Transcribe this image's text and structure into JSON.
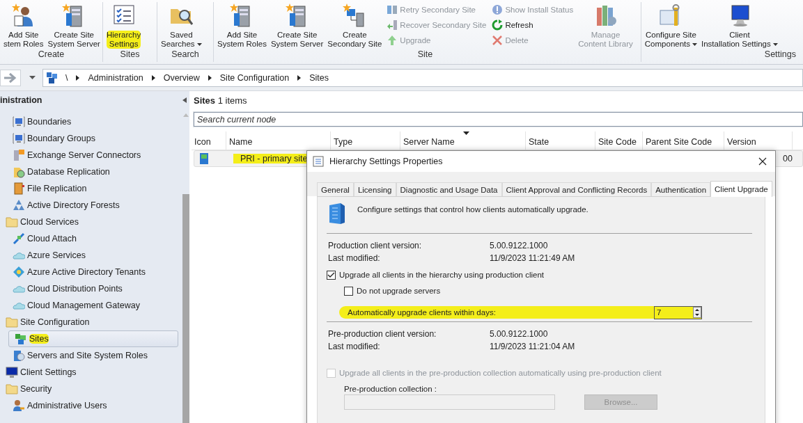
{
  "ribbon": {
    "groups": [
      {
        "label": "Create",
        "items": [
          {
            "kind": "large",
            "lines": [
              "Add Site",
              "stem Roles"
            ],
            "dropdown": false,
            "disabled": false,
            "highlighted": false
          },
          {
            "kind": "large",
            "lines": [
              "Create Site",
              "System Server"
            ],
            "dropdown": false,
            "disabled": false,
            "highlighted": false
          }
        ]
      },
      {
        "label": "Sites",
        "items": [
          {
            "kind": "large",
            "lines": [
              "Hierarchy",
              "Settings"
            ],
            "dropdown": false,
            "disabled": false,
            "highlighted": true
          }
        ]
      },
      {
        "label": "Search",
        "items": [
          {
            "kind": "large",
            "lines": [
              "Saved",
              "Searches"
            ],
            "dropdown": true,
            "disabled": false,
            "highlighted": false
          }
        ]
      },
      {
        "label": "Site",
        "items": [
          {
            "kind": "large",
            "lines": [
              "Add Site",
              "System Roles"
            ],
            "dropdown": false,
            "disabled": false,
            "highlighted": false
          },
          {
            "kind": "large",
            "lines": [
              "Create Site",
              "System Server"
            ],
            "dropdown": false,
            "disabled": false,
            "highlighted": false
          },
          {
            "kind": "large",
            "lines": [
              "Create",
              "Secondary Site"
            ],
            "dropdown": false,
            "disabled": false,
            "highlighted": false
          },
          {
            "kind": "stack",
            "items": [
              {
                "label": "Retry Secondary Site",
                "disabled": true
              },
              {
                "label": "Recover Secondary Site",
                "disabled": true
              },
              {
                "label": "Upgrade",
                "disabled": true
              }
            ]
          },
          {
            "kind": "stack",
            "items": [
              {
                "label": "Show Install Status",
                "disabled": true
              },
              {
                "label": "Refresh",
                "disabled": false
              },
              {
                "label": "Delete",
                "disabled": true
              }
            ]
          },
          {
            "kind": "large",
            "lines": [
              "Manage",
              "Content Library"
            ],
            "dropdown": false,
            "disabled": true,
            "highlighted": false
          }
        ]
      },
      {
        "label": "Settings",
        "items": [
          {
            "kind": "large",
            "lines": [
              "Configure Site",
              "Components"
            ],
            "dropdown": true,
            "disabled": false,
            "highlighted": false
          },
          {
            "kind": "large",
            "lines": [
              "Client",
              "Installation Settings"
            ],
            "dropdown": true,
            "disabled": false,
            "highlighted": false
          }
        ]
      }
    ]
  },
  "breadcrumb": [
    "\\",
    "Administration",
    "Overview",
    "Site Configuration",
    "Sites"
  ],
  "tree": {
    "title": "inistration",
    "items": [
      {
        "children": [
          {
            "label": "Boundaries",
            "selected": false
          },
          {
            "label": "Boundary Groups",
            "selected": false
          },
          {
            "label": "Exchange Server Connectors",
            "selected": false
          },
          {
            "label": "Database Replication",
            "selected": false
          },
          {
            "label": "File Replication",
            "selected": false
          },
          {
            "label": "Active Directory Forests",
            "selected": false
          }
        ]
      },
      {
        "label": "Cloud Services",
        "selected": false,
        "children": [
          {
            "label": "Cloud Attach",
            "selected": false
          },
          {
            "label": "Azure Services",
            "selected": false
          },
          {
            "label": "Azure Active Directory Tenants",
            "selected": false
          },
          {
            "label": "Cloud Distribution Points",
            "selected": false
          },
          {
            "label": "Cloud Management Gateway",
            "selected": false
          }
        ]
      },
      {
        "label": "Site Configuration",
        "selected": false,
        "children": [
          {
            "label": "Sites",
            "selected": true,
            "highlighted": true
          },
          {
            "label": "Servers and Site System Roles",
            "selected": false
          }
        ]
      },
      {
        "label": "Client Settings",
        "selected": false
      },
      {
        "label": "Security",
        "selected": false,
        "children": [
          {
            "label": "Administrative Users",
            "selected": false
          }
        ]
      }
    ]
  },
  "list": {
    "heading": "**Sites** 1 items",
    "search": {
      "placeholder": "Search current node"
    },
    "columns": [
      {
        "label": "Icon",
        "sorted": false
      },
      {
        "label": "Name",
        "sorted": false
      },
      {
        "label": "Type",
        "sorted": false
      },
      {
        "label": "Server Name",
        "sorted": true
      },
      {
        "label": "State",
        "sorted": false
      },
      {
        "label": "Site Code",
        "sorted": false
      },
      {
        "label": "Parent Site Code",
        "sorted": false
      },
      {
        "label": "Version",
        "sorted": false
      }
    ],
    "rows": [
      {
        "name": "PRI - primary site",
        "version": "00",
        "highlighted": true
      }
    ]
  },
  "dialog": {
    "title": "Hierarchy Settings Properties",
    "tabs": [
      {
        "label": "General",
        "selected": false
      },
      {
        "label": "Licensing",
        "selected": false
      },
      {
        "label": "Diagnostic and Usage Data",
        "selected": false
      },
      {
        "label": "Client Approval and Conflicting Records",
        "selected": false
      },
      {
        "label": "Authentication",
        "selected": false
      },
      {
        "label": "Client Upgrade",
        "selected": true
      }
    ],
    "description": "Configure settings that control how clients automatically upgrade.",
    "production": [
      {
        "label": "Production client version:",
        "value": "5.00.9122.1000"
      },
      {
        "label": "Last modified:",
        "value": "11/9/2023 11:21:49 AM"
      }
    ],
    "upgrade_all": {
      "label": "Upgrade all clients in the hierarchy using production client",
      "checked": true,
      "disabled": false
    },
    "no_servers": {
      "label": "Do not upgrade servers",
      "checked": false,
      "disabled": false
    },
    "days": {
      "label": "Automatically upgrade clients within days:",
      "value": "7",
      "highlighted": true
    },
    "preproduction": [
      {
        "label": "Pre-production client version:",
        "value": "5.00.9122.1000"
      },
      {
        "label": "Last modified:",
        "value": "11/9/2023 11:21:04 AM"
      }
    ],
    "preprod_upgrade": {
      "label": "Upgrade all clients in the pre-production collection automatically using pre-production client",
      "checked": false,
      "disabled": true
    },
    "collection": {
      "label": "Pre-production collection :",
      "disabled": true
    },
    "browse": {
      "label": "Browse...",
      "disabled": true
    }
  }
}
